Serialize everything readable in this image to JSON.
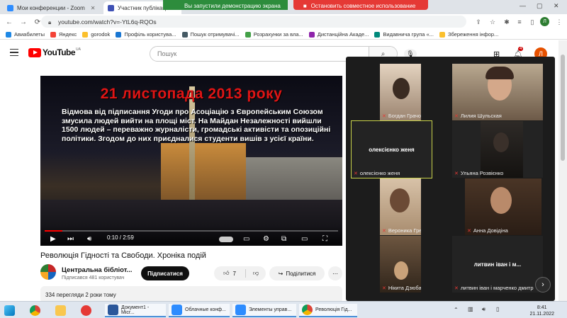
{
  "browser": {
    "tabs": [
      {
        "label": "Мои конференции - Zoom",
        "color": "#2d8cff"
      },
      {
        "label": "Участник публікаци",
        "color": "#3f51b5"
      }
    ],
    "share_banner": {
      "status": "Вы запустили демонстрацию экрана",
      "stop": "Остановить совместное использование"
    },
    "url": "youtube.com/watch?v=-YtL6q-RQOs",
    "profile_initial": "Л",
    "bookmarks": [
      {
        "label": "Авиабилеты",
        "color": "#1e88e5"
      },
      {
        "label": "Яндекс",
        "color": "#f44336"
      },
      {
        "label": "gorodok",
        "color": "#fbc02d"
      },
      {
        "label": "Профіль користува...",
        "color": "#1976d2"
      },
      {
        "label": "Пошук отримувачі...",
        "color": "#455a64"
      },
      {
        "label": "Розрахунки за вла...",
        "color": "#43a047"
      },
      {
        "label": "Дистанційна Акаде...",
        "color": "#8e24aa"
      },
      {
        "label": "Видавнича група «...",
        "color": "#00897b"
      },
      {
        "label": "Збереження інфор...",
        "color": "#fbc02d"
      }
    ]
  },
  "youtube": {
    "logo_text": "YouTube",
    "logo_region": "UA",
    "search_placeholder": "Пошук",
    "notifications": "4",
    "avatar_initial": "Л",
    "video": {
      "overlay_title": "21 листопада 2013 року",
      "overlay_text": "Відмова від підписання Угоди про Асоціацію з Європейським Союзом змусила людей вийти на площі міст. На Майдан Незалежності вийшли 1500 людей – переважно журналісти, громадські активісти та опозиційні політики. Згодом до них приєдналися студенти вишів з усієї країни.",
      "time": "0:10 / 2:59",
      "progress": 0.06
    },
    "title": "Революція Гідності та Свободи. Хроніка подій",
    "channel": "Центральна бібліот...",
    "subscribers": "Підписався 481 користувач",
    "subscribe_label": "Підписатися",
    "likes": "7",
    "share_label": "Поділитися",
    "description": "334 перегляди  2 роки тому"
  },
  "zoom": {
    "participants": [
      {
        "name": "Богдан Грачов",
        "video": true
      },
      {
        "name": "Лилия  Шульская",
        "video": true
      },
      {
        "name": "олексієнко женя",
        "video": false,
        "center": "олексієнко женя"
      },
      {
        "name": "Ульяна Розвієнко",
        "video": true
      },
      {
        "name": "Вероника Гречка",
        "video": true
      },
      {
        "name": "Анна Довідіна",
        "video": true
      },
      {
        "name": "Нікита Дзюба",
        "video": true
      },
      {
        "name": "литвин іван і марченко дмитр",
        "video": false,
        "center": "литвин іван і м..."
      }
    ]
  },
  "taskbar": {
    "items": [
      {
        "label": "Документ1 - Micr...",
        "color": "#2b579a"
      },
      {
        "label": "Облачные конф...",
        "color": "#2d8cff"
      },
      {
        "label": "Элементы управ...",
        "color": "#2d8cff"
      },
      {
        "label": "Революція Гід...",
        "color": "#4caf50"
      }
    ],
    "time": "8:41",
    "date": "21.11.2022"
  }
}
